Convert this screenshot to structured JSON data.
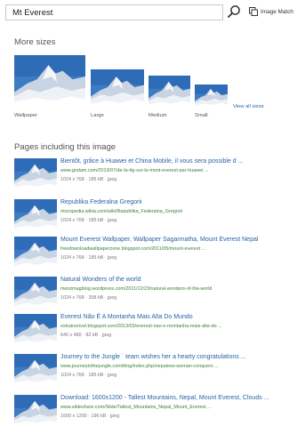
{
  "search": {
    "value": "Mt Everest"
  },
  "image_match": {
    "label": "Image Match"
  },
  "more_sizes": {
    "title": "More sizes",
    "items": [
      {
        "label": "Wallpaper"
      },
      {
        "label": "Large"
      },
      {
        "label": "Medium"
      },
      {
        "label": "Small"
      }
    ],
    "view_all": "View all sizes"
  },
  "pages": {
    "title": "Pages including this image",
    "results": [
      {
        "title": "Bientôt, grâce à Huawei et China Mobile, il vous sera possible d ...",
        "url": "www.gndam.com/2013/07/de-la-4g-sur-le-mont-everest-par-huawei ...",
        "meta": "1024 x 768 · 185 kB · jpeg"
      },
      {
        "title": "Republika Federalna Gregorii",
        "url": "micropedia.wikia.com/wiki/Republika_Federalna_Gregorii",
        "meta": "1024 x 768 · 185 kB · jpeg"
      },
      {
        "title": "Mount Everest Wallpaper, Wallpaper Sagarmatha, Mount Everest Nepal",
        "url": "freedownloadwallpaperzone.blogspot.com/2011/05/mount-everest ...",
        "meta": "1024 x 768 · 185 kB · jpeg"
      },
      {
        "title": "Natural Wonders of the world",
        "url": "menzmagblog.wordpress.com/2011/12/23/natural-wonders-of-the-world",
        "meta": "1024 x 768 · 398 kB · jpeg"
      },
      {
        "title": "Everest Não É A Montanha Mais Alta Do Mundo",
        "url": "extrainorivel.blogspot.com/2013/03/everest-nao-e-montanha-mais-alta-do ...",
        "meta": "640 x 480 · 82 kB · jpeg"
      },
      {
        "title": "Journey to the Jungle ` team wishes her a hearty congratulations ...",
        "url": "www.journeytothejungle.com/blog/index.php/nepalese-woman-conquers ...",
        "meta": "1024 x 768 · 185 kB · jpeg"
      },
      {
        "title": "Download: 1600x1200 - Tallest Mountains, Nepal, Mount Everest, Clouds ...",
        "url": "www.slideshare.com/Slide/Tallest_Mountains_Nepal_Mount_Everest ...",
        "meta": "1600 x 1200 · 196 kB · jpeg"
      }
    ]
  }
}
